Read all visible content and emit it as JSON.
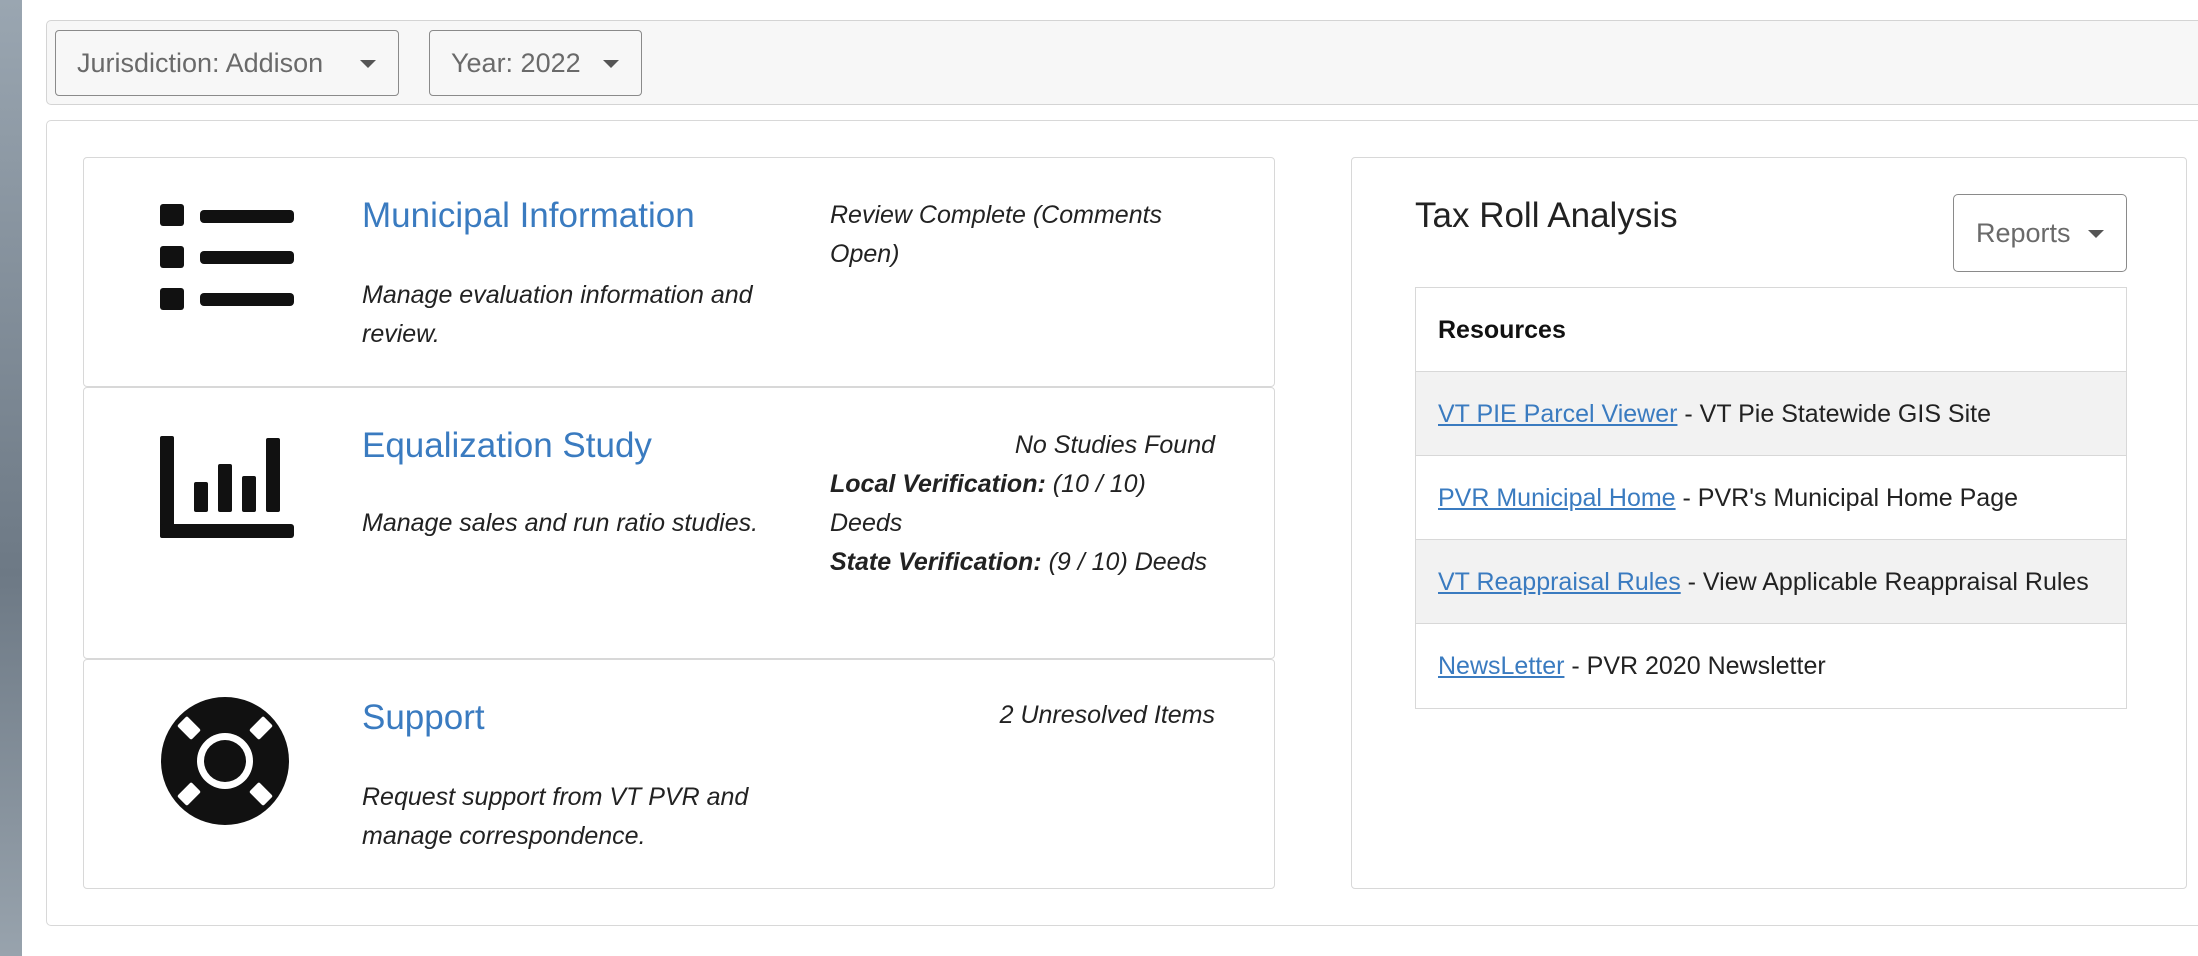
{
  "filters": {
    "jurisdiction_label": "Jurisdiction: Addison",
    "year_label": "Year: 2022"
  },
  "cards": [
    {
      "title": "Municipal Information",
      "description": "Manage evaluation information and review.",
      "status": "Review Complete (Comments Open)",
      "icon": "list-icon"
    },
    {
      "title": "Equalization Study",
      "description": "Manage sales and run ratio studies.",
      "status": "No Studies Found",
      "local_label": "Local Verification:",
      "local_value": " (10 / 10) Deeds",
      "state_label": "State Verification:",
      "state_value": " (9 / 10) Deeds",
      "icon": "bar-chart-icon"
    },
    {
      "title": "Support",
      "description": "Request support from VT PVR and manage correspondence.",
      "status": "2 Unresolved Items",
      "icon": "life-ring-icon"
    }
  ],
  "tax_roll": {
    "title": "Tax Roll Analysis",
    "reports_label": "Reports",
    "table_header": "Resources",
    "resources": [
      {
        "link": "VT PIE Parcel Viewer",
        "text": " - VT Pie Statewide GIS Site"
      },
      {
        "link": "PVR Municipal Home",
        "text": " - PVR's Municipal Home Page"
      },
      {
        "link": "VT Reappraisal Rules",
        "text": " - View Applicable Reappraisal Rules"
      },
      {
        "link": "NewsLetter",
        "text": " - PVR 2020 Newsletter"
      }
    ]
  },
  "colors": {
    "link": "#3a7bc0",
    "icon": "#111111"
  }
}
